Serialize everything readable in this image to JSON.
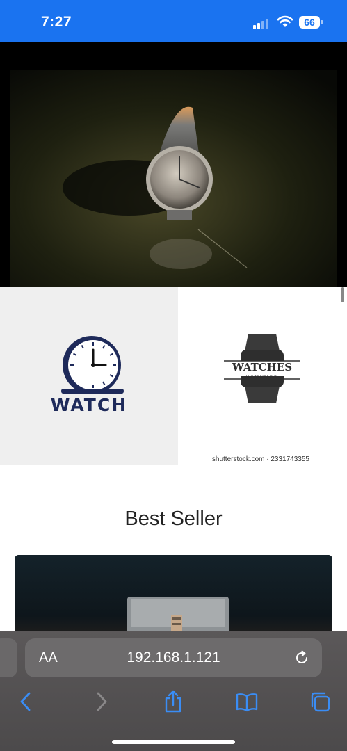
{
  "status_bar": {
    "time": "7:27",
    "battery": "66",
    "signal_icon": "cellular-signal-icon",
    "wifi_icon": "wifi-icon"
  },
  "hero": {
    "image": "wristwatch-photo"
  },
  "logos": {
    "left_text": "WATCH",
    "right_title": "WATCHES",
    "right_slogan": "SLOGAN GOES HERE",
    "credit": "shutterstock.com · 2331743355"
  },
  "best_seller": {
    "title": "Best Seller",
    "product_image": "watch-box-photo"
  },
  "browser": {
    "aa_label": "AA",
    "url": "192.168.1.121",
    "icons": [
      "back-icon",
      "forward-icon",
      "share-icon",
      "bookmarks-icon",
      "tabs-icon",
      "reload-icon"
    ]
  },
  "colors": {
    "status_bar": "#1a73f0",
    "browser_bar": "#4c4a4b",
    "accent": "#3a8df5",
    "logo_navy": "#1e2a5a"
  }
}
